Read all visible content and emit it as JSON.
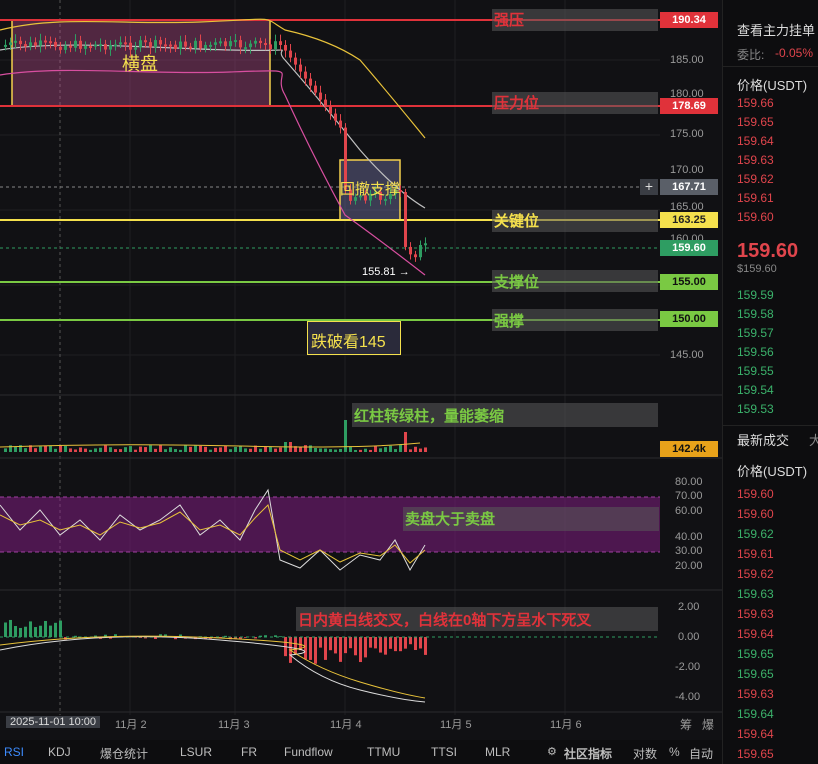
{
  "price_axis": {
    "ticks": [
      "185.00",
      "180.00",
      "175.00",
      "170.00",
      "165.00",
      "160.00",
      "145.00"
    ],
    "tags": [
      {
        "value": "190.34",
        "color": "#e0323a"
      },
      {
        "value": "178.69",
        "color": "#e0323a"
      },
      {
        "value": "167.71",
        "color": "#5a5f68"
      },
      {
        "value": "163.25",
        "color": "#f4e04d"
      },
      {
        "value": "159.60",
        "color": "#2e9d62"
      },
      {
        "value": "155.00",
        "color": "#7ac943"
      },
      {
        "value": "150.00",
        "color": "#7ac943"
      }
    ],
    "volume_tag": "142.4k",
    "rsi_ticks": [
      "80.00",
      "70.00",
      "60.00",
      "40.00",
      "30.00",
      "20.00"
    ],
    "macd_ticks": [
      "2.00",
      "0.00",
      "-2.00",
      "-4.00"
    ]
  },
  "annotations": {
    "strong_pressure": "强压",
    "pressure": "压力位",
    "key_level": "关键位",
    "support": "支撑位",
    "strong_support": "强撑",
    "sideways": "横盘",
    "pullback_support": "回撤支撑",
    "break_145": "跌破看145",
    "low_price": "155.81",
    "volume_note": "红柱转绿柱，量能萎缩",
    "rsi_note": "卖盘大于卖盘",
    "macd_note": "日内黄白线交叉，白线在0轴下方呈水下死叉"
  },
  "time_axis": {
    "labels": [
      "2025-11-01 10:00",
      "11月 2",
      "11月 3",
      "11月 4",
      "11月 5",
      "11月 6"
    ],
    "right": [
      "筹",
      "爆"
    ]
  },
  "indicator_tabs": [
    "RSI",
    "KDJ",
    "爆仓统计",
    "LSUR",
    "FR",
    "Fundflow",
    "TTMU",
    "TTSI",
    "MLR",
    "社区指标",
    "对数",
    "%",
    "自动"
  ],
  "sidebar": {
    "title": "查看主力挂单",
    "ratio_label": "委比:",
    "ratio_value": "-0.05%",
    "price_header": "价格(USDT)",
    "asks": [
      "159.66",
      "159.65",
      "159.64",
      "159.63",
      "159.62",
      "159.61",
      "159.60"
    ],
    "last_price": "159.60",
    "last_price_usd": "$159.60",
    "bids": [
      "159.59",
      "159.58",
      "159.57",
      "159.56",
      "159.55",
      "159.54",
      "159.53"
    ],
    "trades_title": "最新成交",
    "trades_extra": "大",
    "trades_header": "价格(USDT)",
    "trades": [
      {
        "p": "159.60",
        "side": "sell"
      },
      {
        "p": "159.60",
        "side": "sell"
      },
      {
        "p": "159.62",
        "side": "buy"
      },
      {
        "p": "159.61",
        "side": "sell"
      },
      {
        "p": "159.62",
        "side": "sell"
      },
      {
        "p": "159.63",
        "side": "buy"
      },
      {
        "p": "159.63",
        "side": "sell"
      },
      {
        "p": "159.64",
        "side": "sell"
      },
      {
        "p": "159.65",
        "side": "buy"
      },
      {
        "p": "159.65",
        "side": "buy"
      },
      {
        "p": "159.63",
        "side": "sell"
      },
      {
        "p": "159.64",
        "side": "buy"
      },
      {
        "p": "159.64",
        "side": "sell"
      },
      {
        "p": "159.65",
        "side": "sell"
      }
    ]
  }
}
